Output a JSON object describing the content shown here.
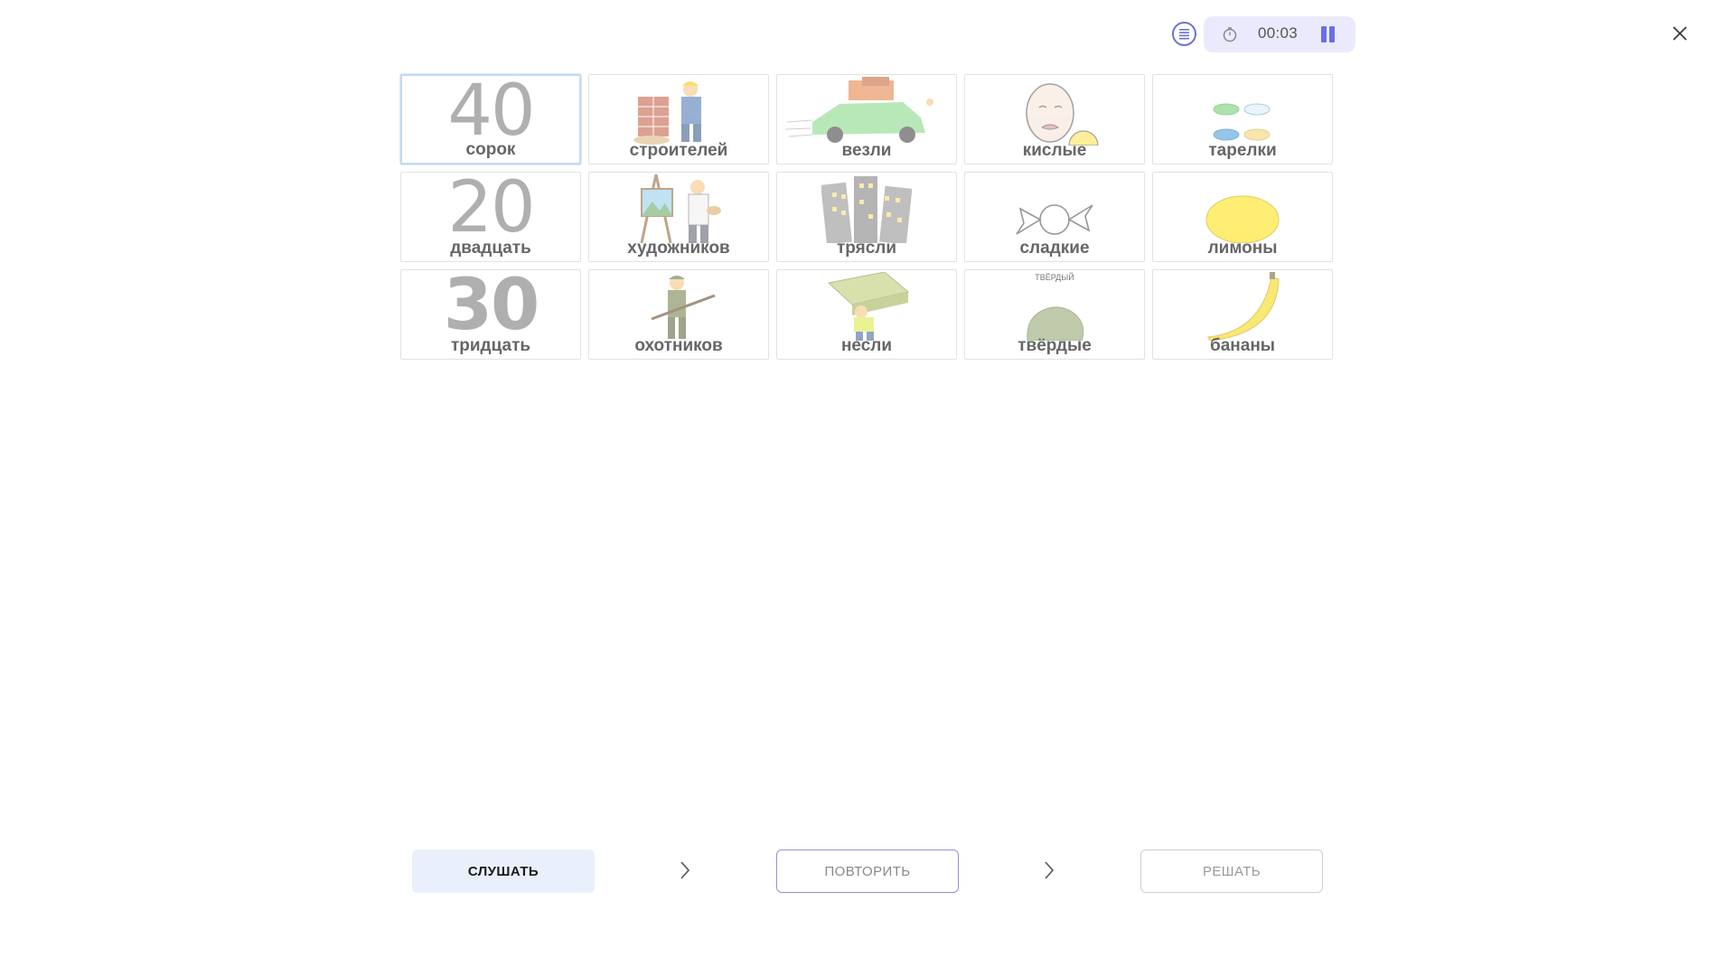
{
  "timer": {
    "value": "00:03"
  },
  "cards": [
    {
      "label": "сорок",
      "numeral": "40",
      "icon": "number-40",
      "selected": true
    },
    {
      "label": "строителей",
      "icon": "builder-icon"
    },
    {
      "label": "везли",
      "icon": "loaded-car-icon"
    },
    {
      "label": "кислые",
      "icon": "sour-face-icon"
    },
    {
      "label": "тарелки",
      "icon": "plates-icon"
    },
    {
      "label": "двадцать",
      "numeral": "20",
      "icon": "number-20"
    },
    {
      "label": "художников",
      "icon": "artist-icon"
    },
    {
      "label": "трясли",
      "icon": "shaking-buildings-icon"
    },
    {
      "label": "сладкие",
      "icon": "candy-icon"
    },
    {
      "label": "лимоны",
      "icon": "lemon-icon"
    },
    {
      "label": "тридцать",
      "numeral": "30",
      "icon": "number-30"
    },
    {
      "label": "охотников",
      "icon": "hunter-icon"
    },
    {
      "label": "несли",
      "icon": "carrying-box-icon"
    },
    {
      "label": "твёрдые",
      "icon": "hard-rock-icon",
      "caption": "ТВЁРДЫЙ"
    },
    {
      "label": "бананы",
      "icon": "banana-icon"
    }
  ],
  "buttons": {
    "listen": "СЛУШАТЬ",
    "repeat": "ПОВТОРИТЬ",
    "solve": "РЕШАТЬ"
  },
  "colors": {
    "accent": "#6a6ee8",
    "selected_border": "#c4daf2",
    "listen_bg": "#e9f0fb",
    "timer_bg": "#ebeafc"
  }
}
